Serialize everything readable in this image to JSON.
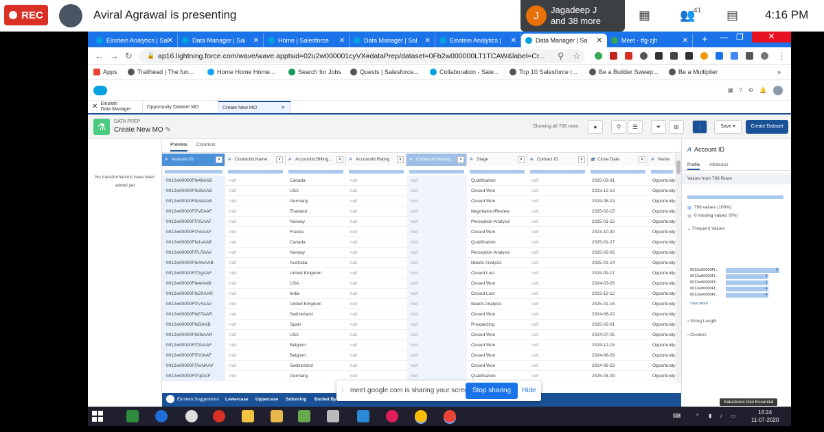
{
  "meet": {
    "rec_label": "REC",
    "presenting_text": "Aviral Agrawal is presenting",
    "participant_initial": "J",
    "participant_name": "Jagadeep J",
    "participant_more": "and 38 more",
    "participant_count": "41",
    "clock": "4:16 PM"
  },
  "browser": {
    "tabs": [
      {
        "label": "Einstein Analytics | Sal"
      },
      {
        "label": "Data Manager | Sal"
      },
      {
        "label": "Home | Salesforce"
      },
      {
        "label": "Data Manager | Sal"
      },
      {
        "label": "Einstein Analytics |"
      },
      {
        "label": "Data Manager | Sa"
      },
      {
        "label": "Meet - tfg-zjh"
      }
    ],
    "url": "ap16.lightning.force.com/wave/wave.apptsid=02u2w000001cyVX#dataPrep/dataset=0Fb2w000000LT1TCAW&label=Cr...",
    "bookmarks": [
      "Apps",
      "Trailhead | The fun...",
      "Home Home Home...",
      "Search for Jobs",
      "Quests | Salesforce...",
      "Collaboration - Sale...",
      "Top 10 Salesforce r...",
      "Be a Builder Sweep...",
      "Be a Multiplier"
    ]
  },
  "sf": {
    "app_tab_line1": "Einstein",
    "app_tab_line2": "Data Manager",
    "tab1": "Opportunity Dataset MO",
    "tab2": "Create New MO",
    "dp_label": "DATA PREP",
    "dp_title": "Create New MO",
    "row_count": "Showing all 706 rows",
    "save": "Save",
    "create": "Create Dataset",
    "preview": "Preview",
    "columns_tab": "Columns",
    "no_trans": "No transformations have been added yet"
  },
  "grid": {
    "headers": [
      "Account ID",
      "ContactId.Name",
      "AccountId.Billing...",
      "AccountId.Rating",
      "ContactId.Mailing...",
      "Stage",
      "Contact ID",
      "Close Date",
      "Name"
    ],
    "rows": [
      [
        "0012w00000Ffe48AAB",
        "null",
        "Canada",
        "null",
        "null",
        "Qualification",
        "null",
        "2025-03-31",
        "Opportunity"
      ],
      [
        "0012w00000Ffe35AAB",
        "null",
        "USA",
        "null",
        "null",
        "Closed Won",
        "null",
        "2023-12-13",
        "Opportunity"
      ],
      [
        "0012w00000Ffe3dAAB",
        "null",
        "Germany",
        "null",
        "null",
        "Closed Won",
        "null",
        "2024-08-19",
        "Opportunity"
      ],
      [
        "0012w00000Ff7vBAAF",
        "null",
        "Thailand",
        "null",
        "null",
        "Negotiation/Review",
        "null",
        "2025-02-15",
        "Opportunity"
      ],
      [
        "0012w00000Ff7z5AAF",
        "null",
        "Norway",
        "null",
        "null",
        "Perception Analysis",
        "null",
        "2025-01-15",
        "Opportunity"
      ],
      [
        "0012w00000Ff7xkAAF",
        "null",
        "France",
        "null",
        "null",
        "Closed Won",
        "null",
        "2023-10-30",
        "Opportunity"
      ],
      [
        "0012w00000Ffe1sAAB",
        "null",
        "Canada",
        "null",
        "null",
        "Qualification",
        "null",
        "2025-01-27",
        "Opportunity"
      ],
      [
        "0012w00000Ff7uTAAV",
        "null",
        "Norway",
        "null",
        "null",
        "Perception Analysis",
        "null",
        "2025-02-02",
        "Opportunity"
      ],
      [
        "0012w00000Ffe4mAAB",
        "null",
        "Australia",
        "null",
        "null",
        "Needs Analysis",
        "null",
        "2025-01-14",
        "Opportunity"
      ],
      [
        "0012w00000Ff7zgAAF",
        "null",
        "United Kingdom",
        "null",
        "null",
        "Closed Lost",
        "null",
        "2024-09-17",
        "Opportunity"
      ],
      [
        "0012w00000Ffe4rAAB",
        "null",
        "USA",
        "null",
        "null",
        "Closed Won",
        "null",
        "2024-03-26",
        "Opportunity"
      ],
      [
        "0012w00000Ffe2XAAR",
        "null",
        "India",
        "null",
        "null",
        "Closed Lost",
        "null",
        "2023-12-12",
        "Opportunity"
      ],
      [
        "0012w00000Ff7vYAAV",
        "null",
        "United Kingdom",
        "null",
        "null",
        "Needs Analysis",
        "null",
        "2025-01-15",
        "Opportunity"
      ],
      [
        "0012w00000Ffe5TAAR",
        "null",
        "Switzerland",
        "null",
        "null",
        "Closed Won",
        "null",
        "2024-06-22",
        "Opportunity"
      ],
      [
        "0012w00000Ffe5iAAB",
        "null",
        "Spain",
        "null",
        "null",
        "Prospecting",
        "null",
        "2025-02-01",
        "Opportunity"
      ],
      [
        "0012w00000Ffe0bAAR",
        "null",
        "USA",
        "null",
        "null",
        "Closed Won",
        "null",
        "2024-07-05",
        "Opportunity"
      ],
      [
        "0012w00000Ff7zbAAF",
        "null",
        "Belgium",
        "null",
        "null",
        "Closed Won",
        "null",
        "2024-12-15",
        "Opportunity"
      ],
      [
        "0012w00000Ff7z0AAF",
        "null",
        "Belgium",
        "null",
        "null",
        "Closed Won",
        "null",
        "2024-08-29",
        "Opportunity"
      ],
      [
        "0012w00000Ff7wNAAV",
        "null",
        "Switzerland",
        "null",
        "null",
        "Closed Won",
        "null",
        "2024-06-23",
        "Opportunity"
      ],
      [
        "0012w00000Ff7qtAAF",
        "null",
        "Germany",
        "null",
        "null",
        "Qualification",
        "null",
        "2025-04-09",
        "Opportunity"
      ]
    ]
  },
  "profile": {
    "title": "Account ID",
    "tab_profile": "Profile",
    "tab_attr": "Attributes",
    "values_from": "Values from 706 Rows",
    "valid": "706 values (100%)",
    "missing": "0 missing values (0%)",
    "frequent": "Frequent Values",
    "freq_items": [
      {
        "label": "0012w00000Ff...",
        "count": "5"
      },
      {
        "label": "0012w00000Ff...",
        "count": "4"
      },
      {
        "label": "0012w00000Ff...",
        "count": "4"
      },
      {
        "label": "0012w00000Ff...",
        "count": "4"
      },
      {
        "label": "0012w00000Ff...",
        "count": "4"
      }
    ],
    "view_more": "View More",
    "string_length": "String Length",
    "clusters": "Clusters"
  },
  "suggestions": {
    "title": "Einstein Suggestions",
    "items": [
      "Lowercase",
      "Uppercase",
      "Substring",
      "Bucket By C"
    ]
  },
  "dev_badge": "Salesforce Dev Essential",
  "share": {
    "text": "meet.google.com is sharing your screen.",
    "stop": "Stop sharing",
    "hide": "Hide"
  },
  "taskbar": {
    "time": "16:24",
    "date": "11-07-2020"
  }
}
